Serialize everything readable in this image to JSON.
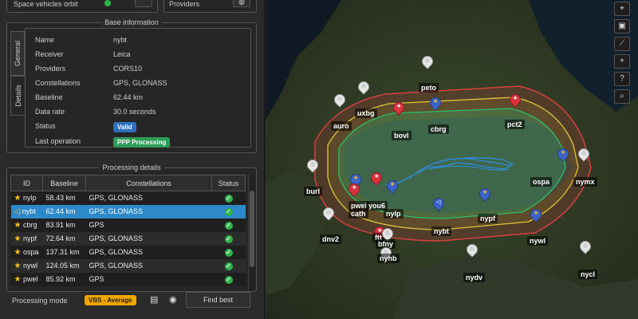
{
  "top": {
    "left_label": "Space vehicles orbit",
    "right_label": "Providers"
  },
  "base_info": {
    "title": "Base information",
    "tabs": [
      "General",
      "Details"
    ],
    "rows": [
      {
        "key": "Name",
        "value": "nybt"
      },
      {
        "key": "Receiver",
        "value": "Leica"
      },
      {
        "key": "Providers",
        "value": "CORS10"
      },
      {
        "key": "Constellations",
        "value": "GPS, GLONASS"
      },
      {
        "key": "Baseline",
        "value": "62.44 km"
      },
      {
        "key": "Data rate",
        "value": "30.0 seconds"
      }
    ],
    "status_label": "Status",
    "status_value": "Valid",
    "last_op_label": "Last operation",
    "last_op_value": "PPP Processing"
  },
  "processing": {
    "title": "Processing details",
    "headers": [
      "ID",
      "Baseline",
      "Constellations",
      "Status"
    ],
    "rows": [
      {
        "id": "nylp",
        "baseline": "58.43 km",
        "constellations": "GPS, GLONASS",
        "icon": "star"
      },
      {
        "id": "nybt",
        "baseline": "62.44 km",
        "constellations": "GPS, GLONASS",
        "icon": "nav",
        "selected": true
      },
      {
        "id": "cbrg",
        "baseline": "83.91 km",
        "constellations": "GPS",
        "icon": "star"
      },
      {
        "id": "nypf",
        "baseline": "72.64 km",
        "constellations": "GPS, GLONASS",
        "icon": "star"
      },
      {
        "id": "ospa",
        "baseline": "137.31 km",
        "constellations": "GPS, GLONASS",
        "icon": "star"
      },
      {
        "id": "nywl",
        "baseline": "124.05 km",
        "constellations": "GPS, GLONASS",
        "icon": "star"
      },
      {
        "id": "pwel",
        "baseline": "85.92 km",
        "constellations": "GPS",
        "icon": "star"
      }
    ],
    "mode_label": "Processing mode",
    "mode_value": "VBS - Average",
    "find_best": "Find best"
  },
  "map": {
    "stations": [
      {
        "name": "peto",
        "kind": "grey"
      },
      {
        "name": "uxbg",
        "kind": "grey"
      },
      {
        "name": "auro",
        "kind": "grey"
      },
      {
        "name": "bovl",
        "kind": "red"
      },
      {
        "name": "cbrg",
        "kind": "blue-star"
      },
      {
        "name": "pct2",
        "kind": "red"
      },
      {
        "name": "burl",
        "kind": "grey"
      },
      {
        "name": "pwel",
        "kind": "blue-star"
      },
      {
        "name": "cath",
        "kind": "red"
      },
      {
        "name": "you6",
        "kind": "red"
      },
      {
        "name": "nylp",
        "kind": "blue-star"
      },
      {
        "name": "ospa",
        "kind": "blue-star"
      },
      {
        "name": "nymx",
        "kind": "grey"
      },
      {
        "name": "nybt",
        "kind": "blue-nav"
      },
      {
        "name": "nypf",
        "kind": "blue-star"
      },
      {
        "name": "dnv2",
        "kind": "grey"
      },
      {
        "name": "ftt",
        "kind": "red"
      },
      {
        "name": "bfny",
        "kind": "grey"
      },
      {
        "name": "nywl",
        "kind": "blue-star"
      },
      {
        "name": "nyhb",
        "kind": "grey"
      },
      {
        "name": "nydv",
        "kind": "grey"
      },
      {
        "name": "nycl",
        "kind": "grey"
      }
    ],
    "tools": [
      "locate-icon",
      "camera-icon",
      "ruler-icon",
      "plus-icon",
      "help-icon",
      "search-icon"
    ]
  },
  "colors": {
    "selection": "#2d89c8",
    "valid": "#2f6fbf",
    "ppp": "#2e9c58",
    "mode": "#f0a500",
    "status_ok": "#2cb34a"
  }
}
